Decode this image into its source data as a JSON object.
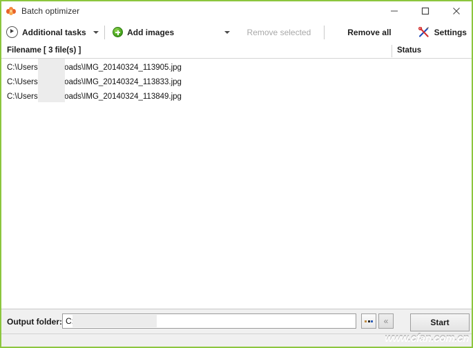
{
  "window": {
    "title": "Batch optimizer",
    "icon": "app-icon",
    "accent_border": "#8cc63e",
    "controls": {
      "minimize": "minimize-icon",
      "maximize": "maximize-icon",
      "close": "close-icon"
    }
  },
  "toolbar": {
    "additional_tasks": "Additional tasks",
    "add_images": "Add images",
    "remove_selected": "Remove selected",
    "remove_all": "Remove all",
    "settings": "Settings"
  },
  "list": {
    "columns": {
      "filename": "Filename [ 3 file(s) ]",
      "status": "Status"
    },
    "rows": [
      {
        "filename": "C:\\Users                \\Downloads\\IMG_20140324_113905.jpg",
        "status": ""
      },
      {
        "filename": "C:\\Users                \\Downloads\\IMG_20140324_113833.jpg",
        "status": ""
      },
      {
        "filename": "C:\\Users                \\Downloads\\IMG_20140324_113849.jpg",
        "status": ""
      }
    ]
  },
  "bottom": {
    "output_folder_label": "Output folder:",
    "output_folder_value": "C:",
    "browse_button": "...",
    "back_button": "«",
    "start_button": "Start"
  },
  "watermark": "www.cfan.com.cn"
}
